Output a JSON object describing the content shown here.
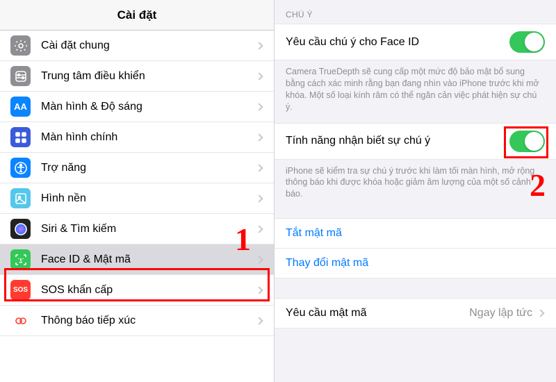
{
  "left": {
    "title": "Cài đặt",
    "items": [
      {
        "label": "Cài đặt chung",
        "icon": "gear",
        "bg": "#8e8e93",
        "fg": "#fff"
      },
      {
        "label": "Trung tâm điều khiển",
        "icon": "sliders",
        "bg": "#8e8e93",
        "fg": "#fff"
      },
      {
        "label": "Màn hình & Độ sáng",
        "icon": "AA",
        "bg": "#0a84ff",
        "fg": "#fff"
      },
      {
        "label": "Màn hình chính",
        "icon": "grid",
        "bg": "#3b5bdb",
        "fg": "#fff"
      },
      {
        "label": "Trợ năng",
        "icon": "access",
        "bg": "#0a84ff",
        "fg": "#fff"
      },
      {
        "label": "Hình nền",
        "icon": "wallpaper",
        "bg": "#54c7ec",
        "fg": "#fff"
      },
      {
        "label": "Siri & Tìm kiếm",
        "icon": "siri",
        "bg": "#222",
        "fg": "#fff"
      },
      {
        "label": "Face ID & Mật mã",
        "icon": "faceid",
        "bg": "#34c759",
        "fg": "#fff",
        "selected": true
      },
      {
        "label": "SOS khẩn cấp",
        "icon": "SOS",
        "bg": "#ff3b30",
        "fg": "#fff"
      },
      {
        "label": "Thông báo tiếp xúc",
        "icon": "exposure",
        "bg": "#fff",
        "fg": "#ff3b30"
      }
    ]
  },
  "right": {
    "section_header": "CHÚ Ý",
    "row1": {
      "label": "Yêu cầu chú ý cho Face ID",
      "toggle": true
    },
    "footer1": "Camera TrueDepth sẽ cung cấp một mức độ bảo mật bổ sung bằng cách xác minh rằng bạn đang nhìn vào iPhone trước khi mở khóa. Một số loại kính râm có thể ngăn cản việc phát hiện sự chú ý.",
    "row2": {
      "label": "Tính năng nhận biết sự chú ý",
      "toggle": true
    },
    "footer2": "iPhone sẽ kiểm tra sự chú ý trước khi làm tối màn hình, mở rộng thông báo khi được khóa hoặc giảm âm lượng của một số cảnh báo.",
    "link1": "Tắt mật mã",
    "link2": "Thay đổi mật mã",
    "detail_row": {
      "label": "Yêu cầu mật mã",
      "value": "Ngay lập tức"
    }
  },
  "annotations": {
    "num1": "1",
    "num2": "2"
  }
}
